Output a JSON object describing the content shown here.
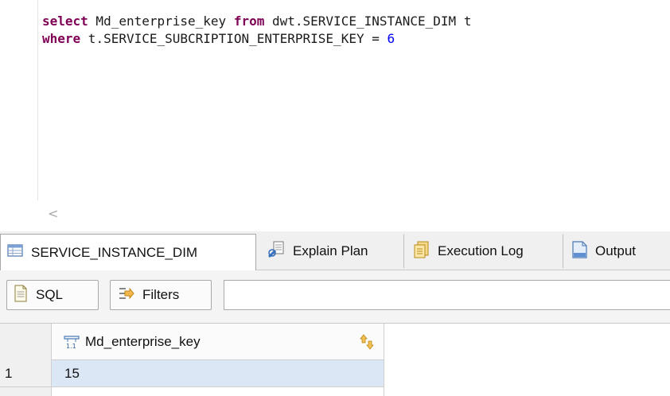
{
  "editor": {
    "line1": {
      "kw1": "select",
      "t1": " Md_enterprise_key ",
      "kw2": "from",
      "t2": " dwt.SERVICE_INSTANCE_DIM t"
    },
    "line2": {
      "kw1": "where",
      "t1": " t.SERVICE_SUBCRIPTION_ENTERPRISE_KEY = ",
      "num": "6"
    }
  },
  "scroll": {
    "left_arrow": "<"
  },
  "tabs": [
    {
      "label": "SERVICE_INSTANCE_DIM",
      "icon": "table-icon",
      "active": true
    },
    {
      "label": "Explain Plan",
      "icon": "explain-plan-icon"
    },
    {
      "label": "Execution Log",
      "icon": "execution-log-icon"
    },
    {
      "label": "Output",
      "icon": "output-icon"
    }
  ],
  "toolbar": {
    "sql_label": "SQL",
    "filters_label": "Filters",
    "filter_value": ""
  },
  "grid": {
    "columns": [
      {
        "label": "Md_enterprise_key",
        "type_icon": "numeric-column-icon",
        "sort_icon": "sort-icon"
      }
    ],
    "rows": [
      {
        "num": "1",
        "cells": [
          "15"
        ]
      }
    ]
  }
}
